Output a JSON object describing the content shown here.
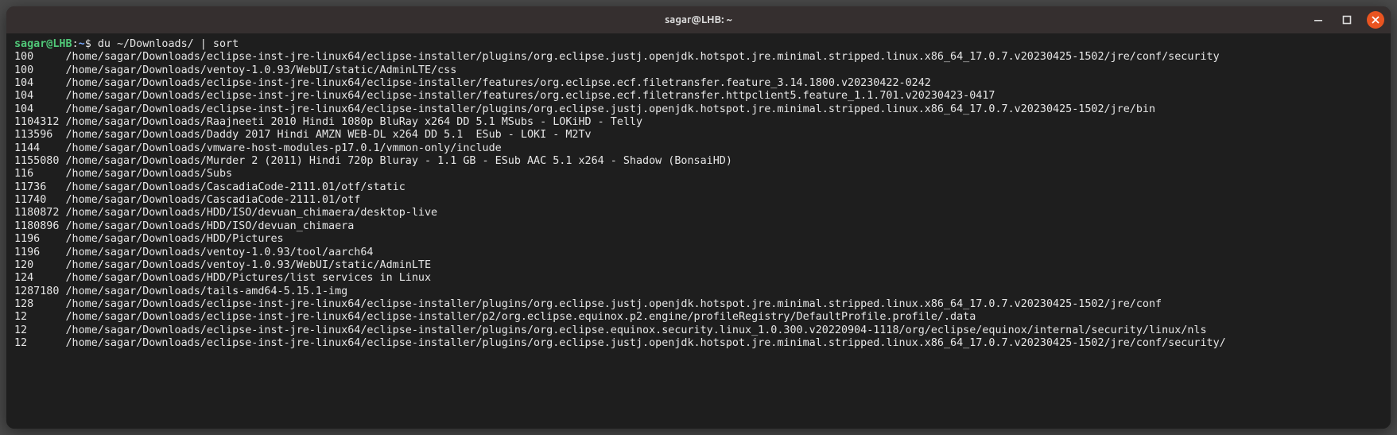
{
  "window": {
    "title": "sagar@LHB: ~"
  },
  "prompt": {
    "user_host": "sagar@LHB",
    "colon": ":",
    "path": "~",
    "dollar": "$ ",
    "command": "du ~/Downloads/ | sort"
  },
  "output": [
    {
      "size": "100",
      "path": "/home/sagar/Downloads/eclipse-inst-jre-linux64/eclipse-installer/plugins/org.eclipse.justj.openjdk.hotspot.jre.minimal.stripped.linux.x86_64_17.0.7.v20230425-1502/jre/conf/security"
    },
    {
      "size": "100",
      "path": "/home/sagar/Downloads/ventoy-1.0.93/WebUI/static/AdminLTE/css"
    },
    {
      "size": "104",
      "path": "/home/sagar/Downloads/eclipse-inst-jre-linux64/eclipse-installer/features/org.eclipse.ecf.filetransfer.feature_3.14.1800.v20230422-0242"
    },
    {
      "size": "104",
      "path": "/home/sagar/Downloads/eclipse-inst-jre-linux64/eclipse-installer/features/org.eclipse.ecf.filetransfer.httpclient5.feature_1.1.701.v20230423-0417"
    },
    {
      "size": "104",
      "path": "/home/sagar/Downloads/eclipse-inst-jre-linux64/eclipse-installer/plugins/org.eclipse.justj.openjdk.hotspot.jre.minimal.stripped.linux.x86_64_17.0.7.v20230425-1502/jre/bin"
    },
    {
      "size": "1104312",
      "path": "/home/sagar/Downloads/Raajneeti 2010 Hindi 1080p BluRay x264 DD 5.1 MSubs - LOKiHD - Telly"
    },
    {
      "size": "113596",
      "path": "/home/sagar/Downloads/Daddy 2017 Hindi AMZN WEB-DL x264 DD 5.1  ESub - LOKI - M2Tv"
    },
    {
      "size": "1144",
      "path": "/home/sagar/Downloads/vmware-host-modules-p17.0.1/vmmon-only/include"
    },
    {
      "size": "1155080",
      "path": "/home/sagar/Downloads/Murder 2 (2011) Hindi 720p Bluray - 1.1 GB - ESub AAC 5.1 x264 - Shadow (BonsaiHD)"
    },
    {
      "size": "116",
      "path": "/home/sagar/Downloads/Subs"
    },
    {
      "size": "11736",
      "path": "/home/sagar/Downloads/CascadiaCode-2111.01/otf/static"
    },
    {
      "size": "11740",
      "path": "/home/sagar/Downloads/CascadiaCode-2111.01/otf"
    },
    {
      "size": "1180872",
      "path": "/home/sagar/Downloads/HDD/ISO/devuan_chimaera/desktop-live"
    },
    {
      "size": "1180896",
      "path": "/home/sagar/Downloads/HDD/ISO/devuan_chimaera"
    },
    {
      "size": "1196",
      "path": "/home/sagar/Downloads/HDD/Pictures"
    },
    {
      "size": "1196",
      "path": "/home/sagar/Downloads/ventoy-1.0.93/tool/aarch64"
    },
    {
      "size": "120",
      "path": "/home/sagar/Downloads/ventoy-1.0.93/WebUI/static/AdminLTE"
    },
    {
      "size": "124",
      "path": "/home/sagar/Downloads/HDD/Pictures/list services in Linux"
    },
    {
      "size": "1287180",
      "path": "/home/sagar/Downloads/tails-amd64-5.15.1-img"
    },
    {
      "size": "128",
      "path": "/home/sagar/Downloads/eclipse-inst-jre-linux64/eclipse-installer/plugins/org.eclipse.justj.openjdk.hotspot.jre.minimal.stripped.linux.x86_64_17.0.7.v20230425-1502/jre/conf"
    },
    {
      "size": "12",
      "path": "/home/sagar/Downloads/eclipse-inst-jre-linux64/eclipse-installer/p2/org.eclipse.equinox.p2.engine/profileRegistry/DefaultProfile.profile/.data"
    },
    {
      "size": "12",
      "path": "/home/sagar/Downloads/eclipse-inst-jre-linux64/eclipse-installer/plugins/org.eclipse.equinox.security.linux_1.0.300.v20220904-1118/org/eclipse/equinox/internal/security/linux/nls"
    },
    {
      "size": "12",
      "path": "/home/sagar/Downloads/eclipse-inst-jre-linux64/eclipse-installer/plugins/org.eclipse.justj.openjdk.hotspot.jre.minimal.stripped.linux.x86_64_17.0.7.v20230425-1502/jre/conf/security/"
    }
  ]
}
